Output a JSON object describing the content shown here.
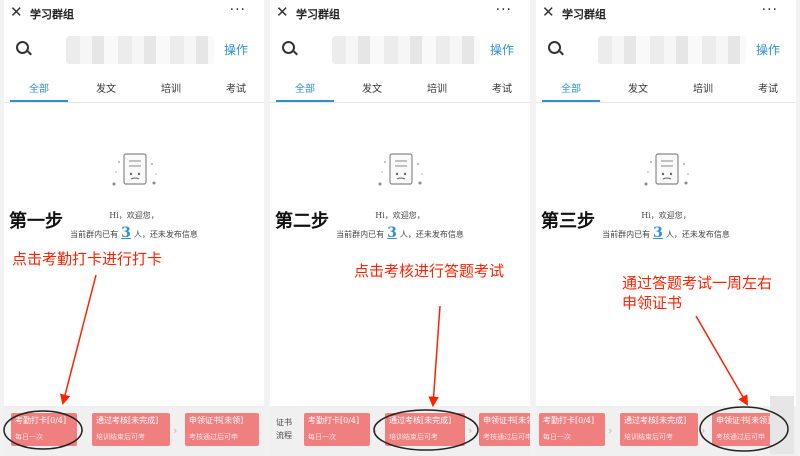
{
  "window": {
    "title": "学习群组",
    "more": "···",
    "close": "✕"
  },
  "header": {
    "action_label": "操作"
  },
  "tabs": [
    {
      "label": "全部"
    },
    {
      "label": "发文"
    },
    {
      "label": "培训"
    },
    {
      "label": "考试"
    }
  ],
  "content": {
    "welcome": "Hi，欢迎您，",
    "status_prefix": "当前群内已有",
    "member_count": "3",
    "status_suffix": "人，还未发布信息"
  },
  "flow_label": "证书流程",
  "cards": [
    {
      "title": "考勤打卡[0/4]",
      "subtitle": "每日一次"
    },
    {
      "title": "通过考核[未完成]",
      "subtitle": "培训结束后可考"
    },
    {
      "title": "申领证书[未领]",
      "subtitle": "考核通过后可申"
    }
  ],
  "panels": [
    {
      "step": "第一步",
      "annotation": "点击考勤打卡进行打卡"
    },
    {
      "step": "第二步",
      "annotation": "点击考核进行答题考试"
    },
    {
      "step": "第三步",
      "annotation": "通过答题考试一周左右申领证书"
    }
  ],
  "colors": {
    "accent": "#2f8fd3",
    "card": "#f08080",
    "annotation": "#ff2200"
  }
}
